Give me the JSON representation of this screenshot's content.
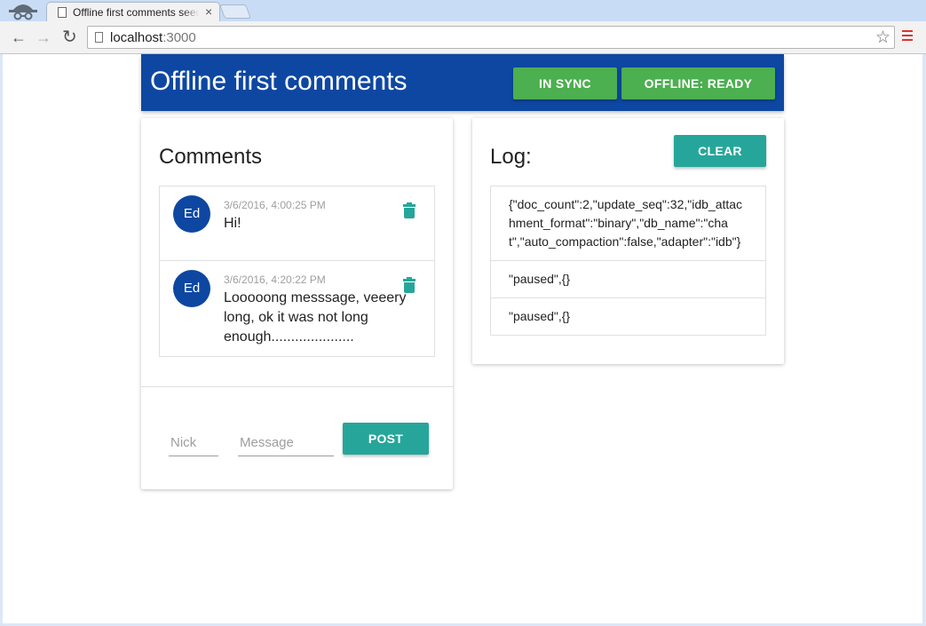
{
  "browser": {
    "tab_title": "Offline first comments seed",
    "tab_close": "×",
    "url_host": "localhost",
    "url_port": ":3000",
    "back": "←",
    "forward": "→",
    "reload": "↻",
    "star": "☆"
  },
  "app": {
    "title": "Offline first comments",
    "sync_button": "IN SYNC",
    "offline_button": "OFFLINE: READY",
    "colors": {
      "primary": "#0d47a1",
      "green": "#4caf50",
      "teal": "#26a69a"
    }
  },
  "comments": {
    "title": "Comments",
    "items": [
      {
        "avatar": "Ed",
        "date": "3/6/2016, 4:00:25 PM",
        "text": "Hi!"
      },
      {
        "avatar": "Ed",
        "date": "3/6/2016, 4:20:22 PM",
        "text": "Looooong messsage, veeery long, ok it was not long enough....................."
      }
    ],
    "form": {
      "nick_placeholder": "Nick",
      "message_placeholder": "Message",
      "post_label": "POST"
    }
  },
  "log": {
    "title": "Log:",
    "clear_label": "CLEAR",
    "entries": [
      "{\"doc_count\":2,\"update_seq\":32,\"idb_attachment_format\":\"binary\",\"db_name\":\"chat\",\"auto_compaction\":false,\"adapter\":\"idb\"}",
      "\"paused\",{}",
      "\"paused\",{}"
    ]
  }
}
